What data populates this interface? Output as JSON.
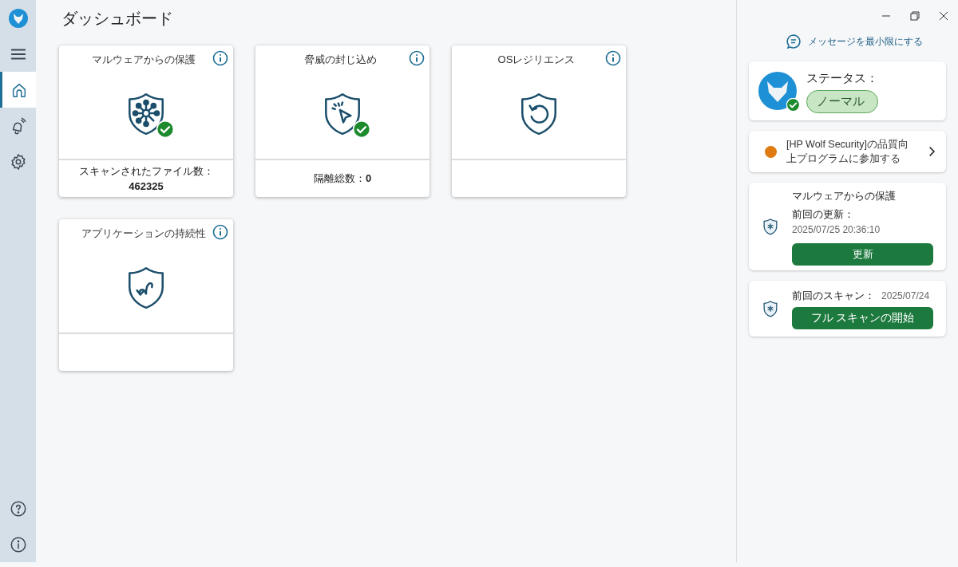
{
  "page_title": "ダッシュボード",
  "sidebar": {
    "items": [
      {
        "kind": "menu",
        "selected": false
      },
      {
        "kind": "home",
        "selected": true
      },
      {
        "kind": "alerts",
        "selected": false
      },
      {
        "kind": "settings",
        "selected": false
      }
    ],
    "bottom_items": [
      {
        "kind": "help"
      },
      {
        "kind": "about"
      }
    ]
  },
  "tiles": [
    {
      "title": "マルウェアからの保護",
      "kind": "network",
      "ok": true,
      "footer_label": "スキャンされたファイル数：",
      "footer_value": "462325"
    },
    {
      "title": "脅威の封じ込め",
      "kind": "cursor",
      "ok": true,
      "footer_label": "隔離総数：",
      "footer_value": "0"
    },
    {
      "title": "OSレジリエンス",
      "kind": "restore",
      "ok": false
    },
    {
      "title": "アプリケーションの持続性",
      "kind": "loop",
      "ok": false
    }
  ],
  "right_panel": {
    "minimize_messages": "メッセージを最小限にする",
    "status": {
      "label": "ステータス：",
      "value": "ノーマル",
      "ok": true
    },
    "survey": {
      "text": "[HP Wolf Security]の品質向上プログラムに参加する",
      "color": "#e07b12"
    },
    "malware": {
      "title": "マルウェアからの保護",
      "updated_label": "前回の更新：",
      "updated_value": "2025/07/25 20:36:10",
      "button": "更新"
    },
    "scan": {
      "label": "前回のスキャン：",
      "value": "2025/07/24",
      "button": "フル スキャンの開始"
    }
  }
}
